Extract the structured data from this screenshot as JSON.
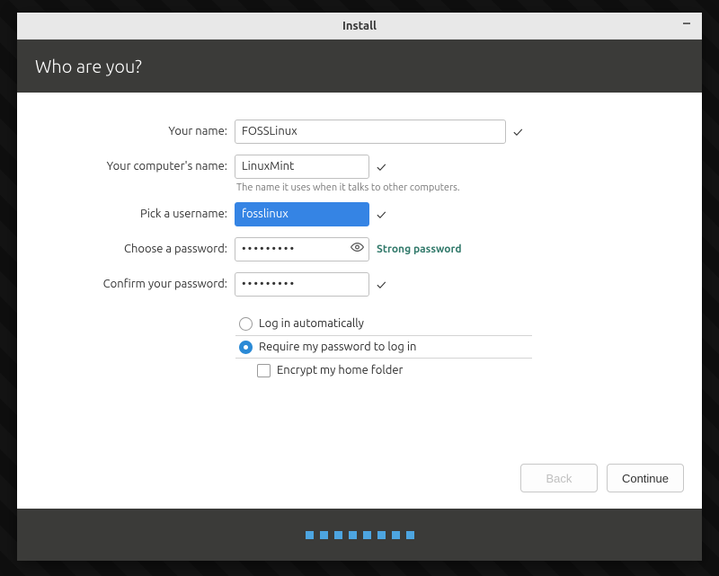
{
  "window_title": "Install",
  "header_title": "Who are you?",
  "form": {
    "name_label": "Your name:",
    "name_value": "FOSSLinux",
    "computer_label": "Your computer's name:",
    "computer_value": "LinuxMint",
    "computer_help": "The name it uses when it talks to other computers.",
    "username_label": "Pick a username:",
    "username_value": "fosslinux",
    "password_label": "Choose a password:",
    "password_value": "•••••••••",
    "password_strength": "Strong password",
    "confirm_label": "Confirm your password:",
    "confirm_value": "•••••••••",
    "option_auto": "Log in automatically",
    "option_require": "Require my password to log in",
    "option_encrypt": "Encrypt my home folder"
  },
  "buttons": {
    "back": "Back",
    "continue": "Continue"
  },
  "progress_total": 8
}
